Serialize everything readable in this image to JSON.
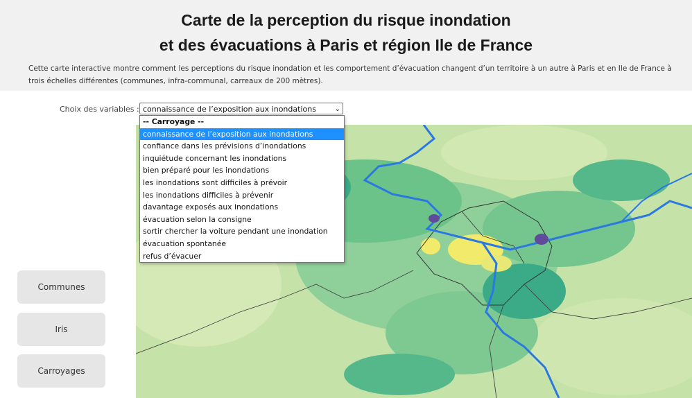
{
  "header": {
    "title_line1": "Carte de la perception du risque inondation",
    "title_line2": "et des évacuations à Paris et région Ile de France",
    "description": "Cette carte interactive montre comment les perceptions du risque inondation et les comportement d’évacuation changent d’un territoire à un autre à Paris et en Ile de France à trois échelles différentes (communes, infra-communal, carreaux de 200 mètres)."
  },
  "variables": {
    "label": "Choix des variables :",
    "selected": "connaissance de l’exposition aux inondations",
    "options": [
      "-- Carroyage --",
      "connaissance de l’exposition aux inondations",
      "confiance dans les prévisions d’inondations",
      "inquiétude concernant les inondations",
      "bien préparé pour les inondations",
      "les inondations sont difficiles à prévoir",
      "les inondations difficiles à prévenir",
      "davantage exposés aux inondations",
      "évacuation selon la consigne",
      "sortir chercher la voiture pendant une inondation",
      "évacuation spontanée",
      "refus d’évacuer"
    ]
  },
  "buttons": {
    "communes": "Communes",
    "iris": "Iris",
    "carroyages": "Carroyages"
  },
  "colors": {
    "header_bg": "#f1f1f1",
    "map_light": "#c5e2a8",
    "map_mid": "#6cc389",
    "map_dark": "#3aab86",
    "map_yellow": "#f2ea6a",
    "river": "#2a78e0",
    "selection": "#1e90ff"
  }
}
